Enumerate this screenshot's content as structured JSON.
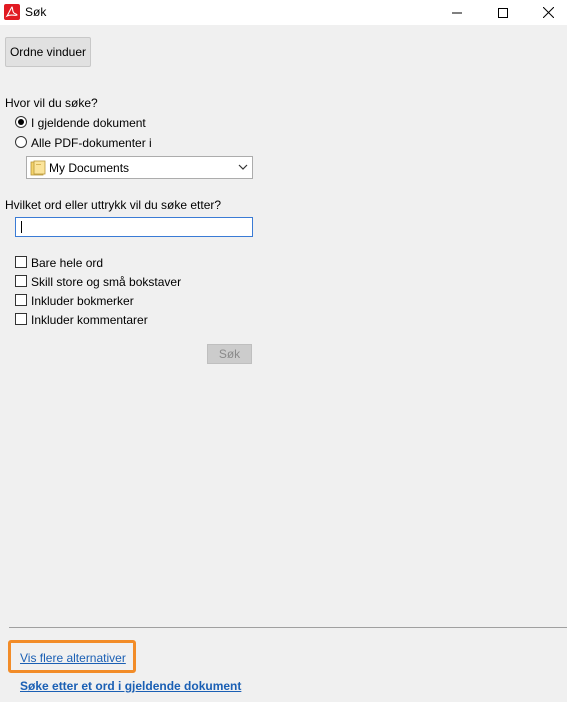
{
  "window": {
    "title": "Søk",
    "app_icon": "adobe-acrobat-icon",
    "controls": [
      "minimize-icon",
      "maximize-icon",
      "close-icon"
    ]
  },
  "toolbar": {
    "arrange_label": "Ordne vinduer"
  },
  "where": {
    "heading": "Hvor vil du søke?",
    "options": [
      {
        "label": "I gjeldende dokument",
        "checked": true
      },
      {
        "label": "Alle PDF-dokumenter i",
        "checked": false
      }
    ],
    "location": {
      "value": "My Documents",
      "icon": "folder-icon"
    }
  },
  "query": {
    "heading": "Hvilket ord eller uttrykk vil du søke etter?",
    "value": ""
  },
  "options": [
    {
      "label": "Bare hele ord",
      "checked": false
    },
    {
      "label": "Skill store og små bokstaver",
      "checked": false
    },
    {
      "label": "Inkluder bokmerker",
      "checked": false
    },
    {
      "label": "Inkluder kommentarer",
      "checked": false
    }
  ],
  "search_button": "Søk",
  "links": {
    "more": "Vis flere alternativer",
    "help": "Søke etter et ord i gjeldende dokument"
  },
  "colors": {
    "accent_link": "#1a5fb4",
    "highlight": "#f28c28",
    "panel_bg": "#f0f0f0",
    "brand_red": "#e11a22"
  }
}
